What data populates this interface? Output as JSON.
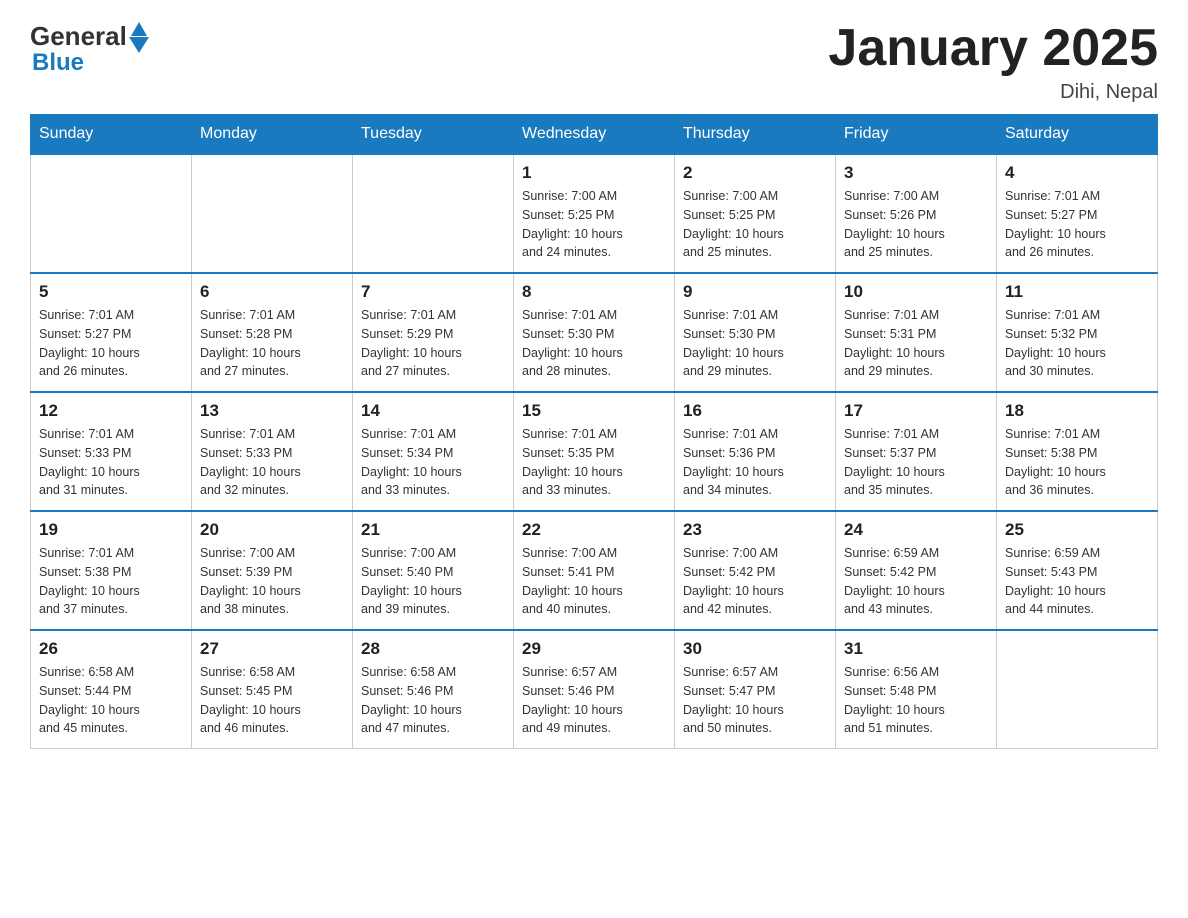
{
  "header": {
    "logo_text": "General",
    "logo_blue": "Blue",
    "title": "January 2025",
    "subtitle": "Dihi, Nepal"
  },
  "weekdays": [
    "Sunday",
    "Monday",
    "Tuesday",
    "Wednesday",
    "Thursday",
    "Friday",
    "Saturday"
  ],
  "weeks": [
    [
      {
        "day": "",
        "info": ""
      },
      {
        "day": "",
        "info": ""
      },
      {
        "day": "",
        "info": ""
      },
      {
        "day": "1",
        "info": "Sunrise: 7:00 AM\nSunset: 5:25 PM\nDaylight: 10 hours\nand 24 minutes."
      },
      {
        "day": "2",
        "info": "Sunrise: 7:00 AM\nSunset: 5:25 PM\nDaylight: 10 hours\nand 25 minutes."
      },
      {
        "day": "3",
        "info": "Sunrise: 7:00 AM\nSunset: 5:26 PM\nDaylight: 10 hours\nand 25 minutes."
      },
      {
        "day": "4",
        "info": "Sunrise: 7:01 AM\nSunset: 5:27 PM\nDaylight: 10 hours\nand 26 minutes."
      }
    ],
    [
      {
        "day": "5",
        "info": "Sunrise: 7:01 AM\nSunset: 5:27 PM\nDaylight: 10 hours\nand 26 minutes."
      },
      {
        "day": "6",
        "info": "Sunrise: 7:01 AM\nSunset: 5:28 PM\nDaylight: 10 hours\nand 27 minutes."
      },
      {
        "day": "7",
        "info": "Sunrise: 7:01 AM\nSunset: 5:29 PM\nDaylight: 10 hours\nand 27 minutes."
      },
      {
        "day": "8",
        "info": "Sunrise: 7:01 AM\nSunset: 5:30 PM\nDaylight: 10 hours\nand 28 minutes."
      },
      {
        "day": "9",
        "info": "Sunrise: 7:01 AM\nSunset: 5:30 PM\nDaylight: 10 hours\nand 29 minutes."
      },
      {
        "day": "10",
        "info": "Sunrise: 7:01 AM\nSunset: 5:31 PM\nDaylight: 10 hours\nand 29 minutes."
      },
      {
        "day": "11",
        "info": "Sunrise: 7:01 AM\nSunset: 5:32 PM\nDaylight: 10 hours\nand 30 minutes."
      }
    ],
    [
      {
        "day": "12",
        "info": "Sunrise: 7:01 AM\nSunset: 5:33 PM\nDaylight: 10 hours\nand 31 minutes."
      },
      {
        "day": "13",
        "info": "Sunrise: 7:01 AM\nSunset: 5:33 PM\nDaylight: 10 hours\nand 32 minutes."
      },
      {
        "day": "14",
        "info": "Sunrise: 7:01 AM\nSunset: 5:34 PM\nDaylight: 10 hours\nand 33 minutes."
      },
      {
        "day": "15",
        "info": "Sunrise: 7:01 AM\nSunset: 5:35 PM\nDaylight: 10 hours\nand 33 minutes."
      },
      {
        "day": "16",
        "info": "Sunrise: 7:01 AM\nSunset: 5:36 PM\nDaylight: 10 hours\nand 34 minutes."
      },
      {
        "day": "17",
        "info": "Sunrise: 7:01 AM\nSunset: 5:37 PM\nDaylight: 10 hours\nand 35 minutes."
      },
      {
        "day": "18",
        "info": "Sunrise: 7:01 AM\nSunset: 5:38 PM\nDaylight: 10 hours\nand 36 minutes."
      }
    ],
    [
      {
        "day": "19",
        "info": "Sunrise: 7:01 AM\nSunset: 5:38 PM\nDaylight: 10 hours\nand 37 minutes."
      },
      {
        "day": "20",
        "info": "Sunrise: 7:00 AM\nSunset: 5:39 PM\nDaylight: 10 hours\nand 38 minutes."
      },
      {
        "day": "21",
        "info": "Sunrise: 7:00 AM\nSunset: 5:40 PM\nDaylight: 10 hours\nand 39 minutes."
      },
      {
        "day": "22",
        "info": "Sunrise: 7:00 AM\nSunset: 5:41 PM\nDaylight: 10 hours\nand 40 minutes."
      },
      {
        "day": "23",
        "info": "Sunrise: 7:00 AM\nSunset: 5:42 PM\nDaylight: 10 hours\nand 42 minutes."
      },
      {
        "day": "24",
        "info": "Sunrise: 6:59 AM\nSunset: 5:42 PM\nDaylight: 10 hours\nand 43 minutes."
      },
      {
        "day": "25",
        "info": "Sunrise: 6:59 AM\nSunset: 5:43 PM\nDaylight: 10 hours\nand 44 minutes."
      }
    ],
    [
      {
        "day": "26",
        "info": "Sunrise: 6:58 AM\nSunset: 5:44 PM\nDaylight: 10 hours\nand 45 minutes."
      },
      {
        "day": "27",
        "info": "Sunrise: 6:58 AM\nSunset: 5:45 PM\nDaylight: 10 hours\nand 46 minutes."
      },
      {
        "day": "28",
        "info": "Sunrise: 6:58 AM\nSunset: 5:46 PM\nDaylight: 10 hours\nand 47 minutes."
      },
      {
        "day": "29",
        "info": "Sunrise: 6:57 AM\nSunset: 5:46 PM\nDaylight: 10 hours\nand 49 minutes."
      },
      {
        "day": "30",
        "info": "Sunrise: 6:57 AM\nSunset: 5:47 PM\nDaylight: 10 hours\nand 50 minutes."
      },
      {
        "day": "31",
        "info": "Sunrise: 6:56 AM\nSunset: 5:48 PM\nDaylight: 10 hours\nand 51 minutes."
      },
      {
        "day": "",
        "info": ""
      }
    ]
  ]
}
